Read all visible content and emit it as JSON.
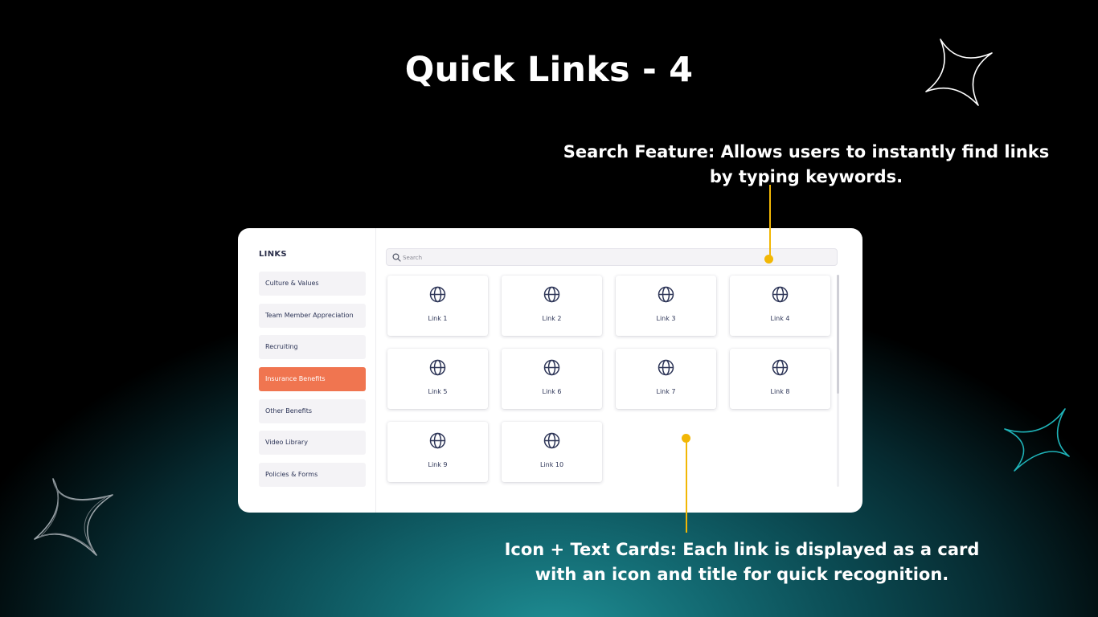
{
  "slide": {
    "title": "Quick Links - 4",
    "callout_search": "Search Feature: Allows users to instantly find links by typing keywords.",
    "callout_cards": "Icon + Text Cards: Each link is displayed as a card with an icon and title for quick recognition."
  },
  "colors": {
    "accent": "#f07550",
    "callout_line": "#f2b705",
    "icon": "#2d3557"
  },
  "app": {
    "sidebar": {
      "title": "LINKS",
      "items": [
        {
          "label": "Culture & Values"
        },
        {
          "label": "Team Member Appreciation"
        },
        {
          "label": "Recruiting"
        },
        {
          "label": "Insurance Benefits",
          "active": true
        },
        {
          "label": "Other Benefits"
        },
        {
          "label": "Video Library"
        },
        {
          "label": "Policies & Forms"
        }
      ]
    },
    "search": {
      "placeholder": "Search",
      "value": "",
      "icon": "search-icon"
    },
    "cards": [
      {
        "label": "Link 1",
        "icon": "globe-icon"
      },
      {
        "label": "Link 2",
        "icon": "globe-icon"
      },
      {
        "label": "Link 3",
        "icon": "globe-icon"
      },
      {
        "label": "Link 4",
        "icon": "globe-icon"
      },
      {
        "label": "Link 5",
        "icon": "globe-icon"
      },
      {
        "label": "Link 6",
        "icon": "globe-icon"
      },
      {
        "label": "Link 7",
        "icon": "globe-icon"
      },
      {
        "label": "Link 8",
        "icon": "globe-icon"
      },
      {
        "label": "Link 9",
        "icon": "globe-icon"
      },
      {
        "label": "Link 10",
        "icon": "globe-icon"
      }
    ]
  }
}
